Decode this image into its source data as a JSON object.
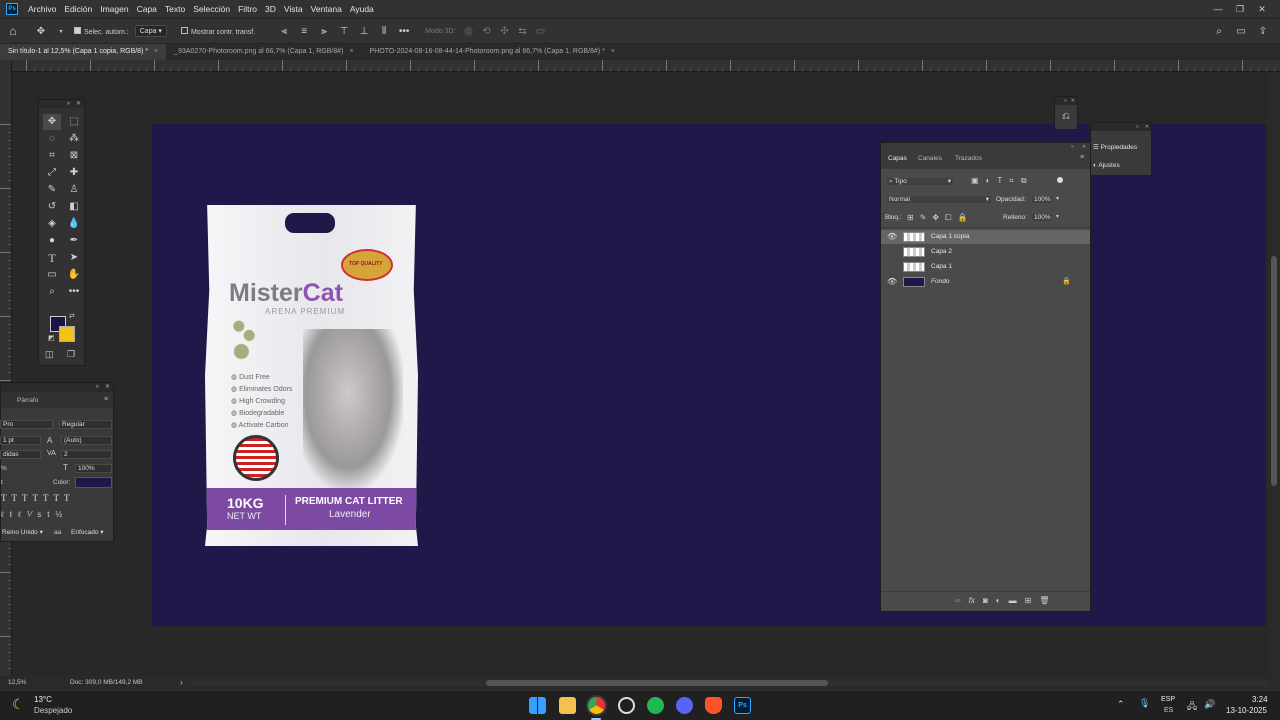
{
  "menubar": {
    "app_icon": "Ps",
    "items": [
      "Archivo",
      "Edición",
      "Imagen",
      "Capa",
      "Texto",
      "Selección",
      "Filtro",
      "3D",
      "Vista",
      "Ventana",
      "Ayuda"
    ]
  },
  "options_bar": {
    "auto_select_label": "Selec. autom.:",
    "auto_select_value": "Capa",
    "show_transform_label": "Mostrar contr. transf.",
    "mode3d_label": "Modo 3D:"
  },
  "tabs": [
    {
      "label": "Sin título-1 al 12,5% (Capa 1 copia, RGB/8) *",
      "close": "×"
    },
    {
      "label": "_93A0270-Photoroom.png al 66,7% (Capa 1, RGB/8#)",
      "close": "×"
    },
    {
      "label": "PHOTO-2024-08-16-08-44-14-Photoroom.png al 66,7% (Capa 1, RGB/8#) *",
      "close": "×"
    }
  ],
  "product": {
    "brand_a": "Mister",
    "brand_b": "Cat",
    "subtitle": "ARENA PREMIUM",
    "badge": "TOP QUALITY",
    "features": [
      "Dust Free",
      "Eliminates Odors",
      "High Crowding",
      "Biodegradable",
      "Activate Carbon"
    ],
    "weight": "10KG",
    "net": "NET WT",
    "product_name": "PREMIUM CAT LITTER",
    "scent": "Lavender"
  },
  "character_panel": {
    "tab": "Párrafo",
    "font": "Pro",
    "style": "Regular",
    "size": "1 pt",
    "leading": "(Auto)",
    "kerning": "didas",
    "tracking": "2",
    "vscale": "100%",
    "color_label": "Color:",
    "language": "Reino Unido",
    "antialias": "Enfocado",
    "pct": "%",
    "pt": "t",
    "aa_icon": "aa"
  },
  "layers_panel": {
    "tabs": [
      "Capas",
      "Canales",
      "Trazados"
    ],
    "filter": "Tipo",
    "blend": "Normal",
    "opacity_label": "Opacidad:",
    "opacity": "100%",
    "lock_label": "Bloq.:",
    "fill_label": "Relleno:",
    "fill": "100%",
    "layers": [
      {
        "name": "Capa 1 copia",
        "visible": true,
        "selected": true
      },
      {
        "name": "Capa 2",
        "visible": false,
        "selected": false
      },
      {
        "name": "Capa 1",
        "visible": false,
        "selected": false
      },
      {
        "name": "Fondo",
        "visible": true,
        "selected": false,
        "locked": true
      }
    ],
    "footer_icons": [
      "link-icon",
      "fx-icon",
      "mask-icon",
      "adjustment-icon",
      "folder-icon",
      "new-layer-icon",
      "trash-icon"
    ]
  },
  "properties_panel": {
    "items": [
      "Propiedades",
      "Ajustes"
    ]
  },
  "status_bar": {
    "zoom": "12,5%",
    "doc": "Doc: 309,0 MB/149,2 MB"
  },
  "taskbar": {
    "temp": "13°C",
    "weather": "Despejado",
    "lang": "ESP",
    "lang_sub": "ES",
    "time": "3:24",
    "date": "13-10-2025"
  },
  "colors": {
    "canvas": "#1f1848",
    "foreground": "#1a1545",
    "background": "#f2c21a",
    "accent_purple": "#7c4aa3"
  }
}
